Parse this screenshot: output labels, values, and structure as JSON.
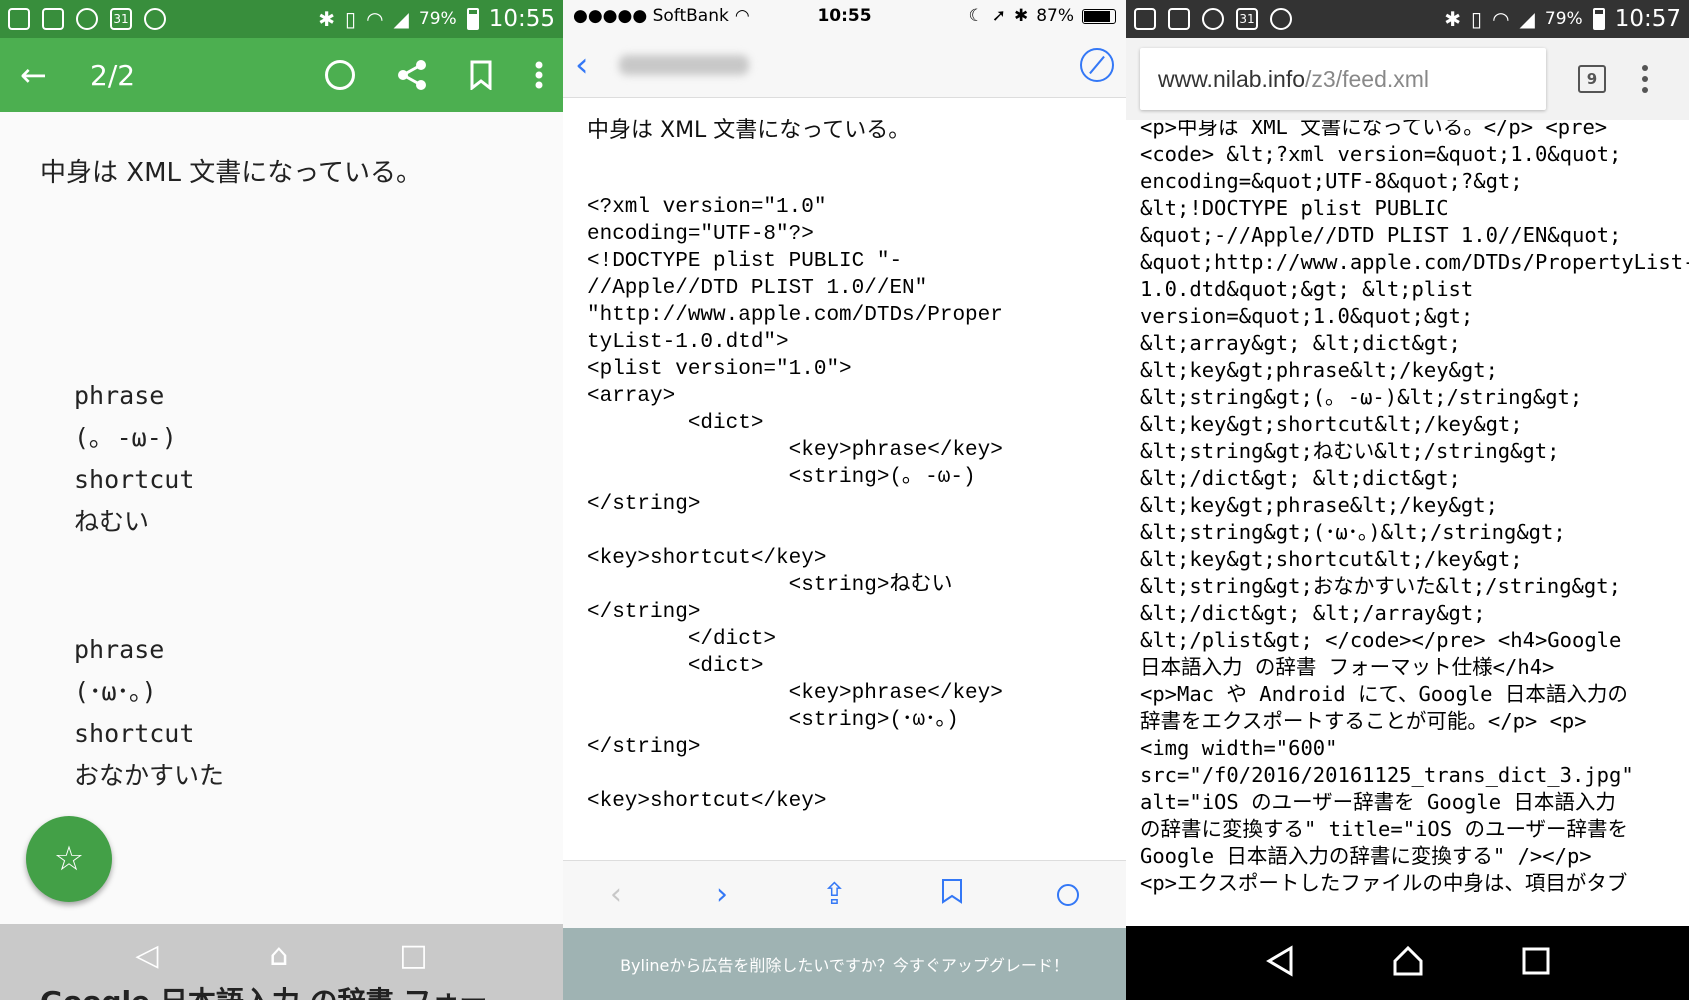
{
  "panel1": {
    "status": {
      "battery": "79%",
      "time": "10:55",
      "calendar_day": "31"
    },
    "toolbar": {
      "counter": "2/2"
    },
    "intro": "中身は XML 文書になっている。",
    "entries": [
      {
        "k1": "phrase",
        "v1": "(｡ -ω-)",
        "k2": "shortcut",
        "v2": "ねむい"
      },
      {
        "k1": "phrase",
        "v1": "(･ω･｡)",
        "k2": "shortcut",
        "v2": "おなかすいた"
      }
    ],
    "peek_heading": "Google 日本語入力 の辞書 フォー"
  },
  "panel2": {
    "status": {
      "carrier": "●●●●● SoftBank",
      "time": "10:55",
      "battery": "87%"
    },
    "intro": "中身は XML 文書になっている。",
    "code": "<?xml version=\"1.0\"\nencoding=\"UTF-8\"?>\n<!DOCTYPE plist PUBLIC \"-\n//Apple//DTD PLIST 1.0//EN\"\n\"http://www.apple.com/DTDs/Proper\ntyList-1.0.dtd\">\n<plist version=\"1.0\">\n<array>\n        <dict>\n                <key>phrase</key>\n                <string>(｡ -ω-)\n</string>\n\n<key>shortcut</key>\n                <string>ねむい\n</string>\n        </dict>\n        <dict>\n                <key>phrase</key>\n                <string>(･ω･｡)\n</string>\n\n<key>shortcut</key>",
    "ad": "Bylineから広告を削除したいですか？今すぐアップグレード！"
  },
  "panel3": {
    "status": {
      "battery": "79%",
      "time": "10:57",
      "calendar_day": "31"
    },
    "url_host": "www.nilab.info",
    "url_path": "/z3/feed.xml",
    "tab_count": "9",
    "source": "<p>中身は XML 文書になっている。</p> <pre>\n<code> &lt;?xml version=&quot;1.0&quot;\nencoding=&quot;UTF-8&quot;?&gt;\n&lt;!DOCTYPE plist PUBLIC\n&quot;-//Apple//DTD PLIST 1.0//EN&quot;\n&quot;http://www.apple.com/DTDs/PropertyList-\n1.0.dtd&quot;&gt; &lt;plist\nversion=&quot;1.0&quot;&gt;\n&lt;array&gt; &lt;dict&gt;\n&lt;key&gt;phrase&lt;/key&gt;\n&lt;string&gt;(｡ -ω-)&lt;/string&gt;\n&lt;key&gt;shortcut&lt;/key&gt;\n&lt;string&gt;ねむい&lt;/string&gt;\n&lt;/dict&gt; &lt;dict&gt;\n&lt;key&gt;phrase&lt;/key&gt;\n&lt;string&gt;(･ω･｡)&lt;/string&gt;\n&lt;key&gt;shortcut&lt;/key&gt;\n&lt;string&gt;おなかすいた&lt;/string&gt;\n&lt;/dict&gt; &lt;/array&gt;\n&lt;/plist&gt; </code></pre> <h4>Google\n日本語入力 の辞書 フォーマット仕様</h4>\n<p>Mac や Android にて、Google 日本語入力の\n辞書をエクスポートすることが可能。</p> <p>\n<img width=\"600\"\nsrc=\"/f0/2016/20161125_trans_dict_3.jpg\"\nalt=\"iOS のユーザー辞書を Google 日本語入力\nの辞書に変換する\" title=\"iOS のユーザー辞書を\nGoogle 日本語入力の辞書に変換する\" /></p>\n<p>エクスポートしたファイルの中身は、項目がタブ"
  }
}
